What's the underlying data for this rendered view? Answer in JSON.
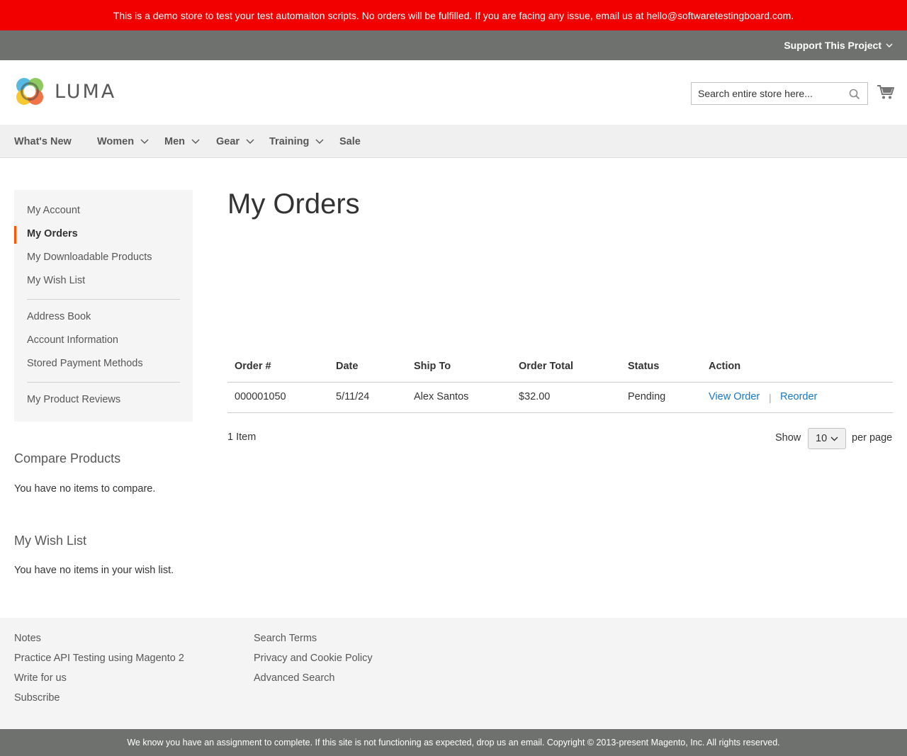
{
  "demo_banner": "This is a demo store to test your test automaiton scripts. No orders will be fulfilled. If you are facing any issue, email us at hello@softwaretestingboard.com.",
  "support_bar": {
    "link_label": "Support This Project"
  },
  "header": {
    "logo_text": "LUMA",
    "search_placeholder": "Search entire store here...",
    "icons": [
      "search-icon",
      "cart-icon",
      "chevron-down-icon"
    ]
  },
  "nav": {
    "items": [
      {
        "label": "What's New"
      },
      {
        "label": "Women"
      },
      {
        "label": "Men"
      },
      {
        "label": "Gear"
      },
      {
        "label": "Training"
      },
      {
        "label": "Sale"
      }
    ]
  },
  "sidebar": {
    "items": [
      {
        "label": "My Account"
      },
      {
        "label": "My Orders"
      },
      {
        "label": "My Downloadable Products"
      },
      {
        "label": "My Wish List"
      },
      {
        "label": "Address Book"
      },
      {
        "label": "Account Information"
      },
      {
        "label": "Stored Payment Methods"
      },
      {
        "label": "My Product Reviews"
      }
    ],
    "active_accent_color": "#ff5501"
  },
  "compare": {
    "title": "Compare Products",
    "text": "You have no items to compare."
  },
  "wishlist": {
    "title": "My Wish List",
    "text": "You have no items in your wish list."
  },
  "main": {
    "title": "My Orders",
    "table": {
      "headers": [
        "Order #",
        "Date",
        "Ship To",
        "Order Total",
        "Status",
        "Action"
      ],
      "rows": [
        {
          "order": "000001050",
          "date": "5/11/24",
          "ship_to": "Alex Santos",
          "total": "$32.00",
          "status": "Pending",
          "view_label": "View Order",
          "reorder_label": "Reorder"
        }
      ]
    },
    "toolbar": {
      "amount": "1 Item",
      "show_label": "Show",
      "limiter_value": "10",
      "per_page_label": "per page"
    }
  },
  "footer": {
    "col1": [
      "Notes",
      "Practice API Testing using Magento 2",
      "Write for us",
      "Subscribe"
    ],
    "col2": [
      "Search Terms",
      "Privacy and Cookie Policy",
      "Advanced Search"
    ],
    "copyright": "We know you have an assignment to complete. If this site is not functioning as expected, drop us an email. Copyright © 2013-present Magento, Inc. All rights reserved."
  },
  "colors": {
    "banner_bg": "#f20000",
    "bar_bg": "#6e716e",
    "link": "#1979c3"
  }
}
